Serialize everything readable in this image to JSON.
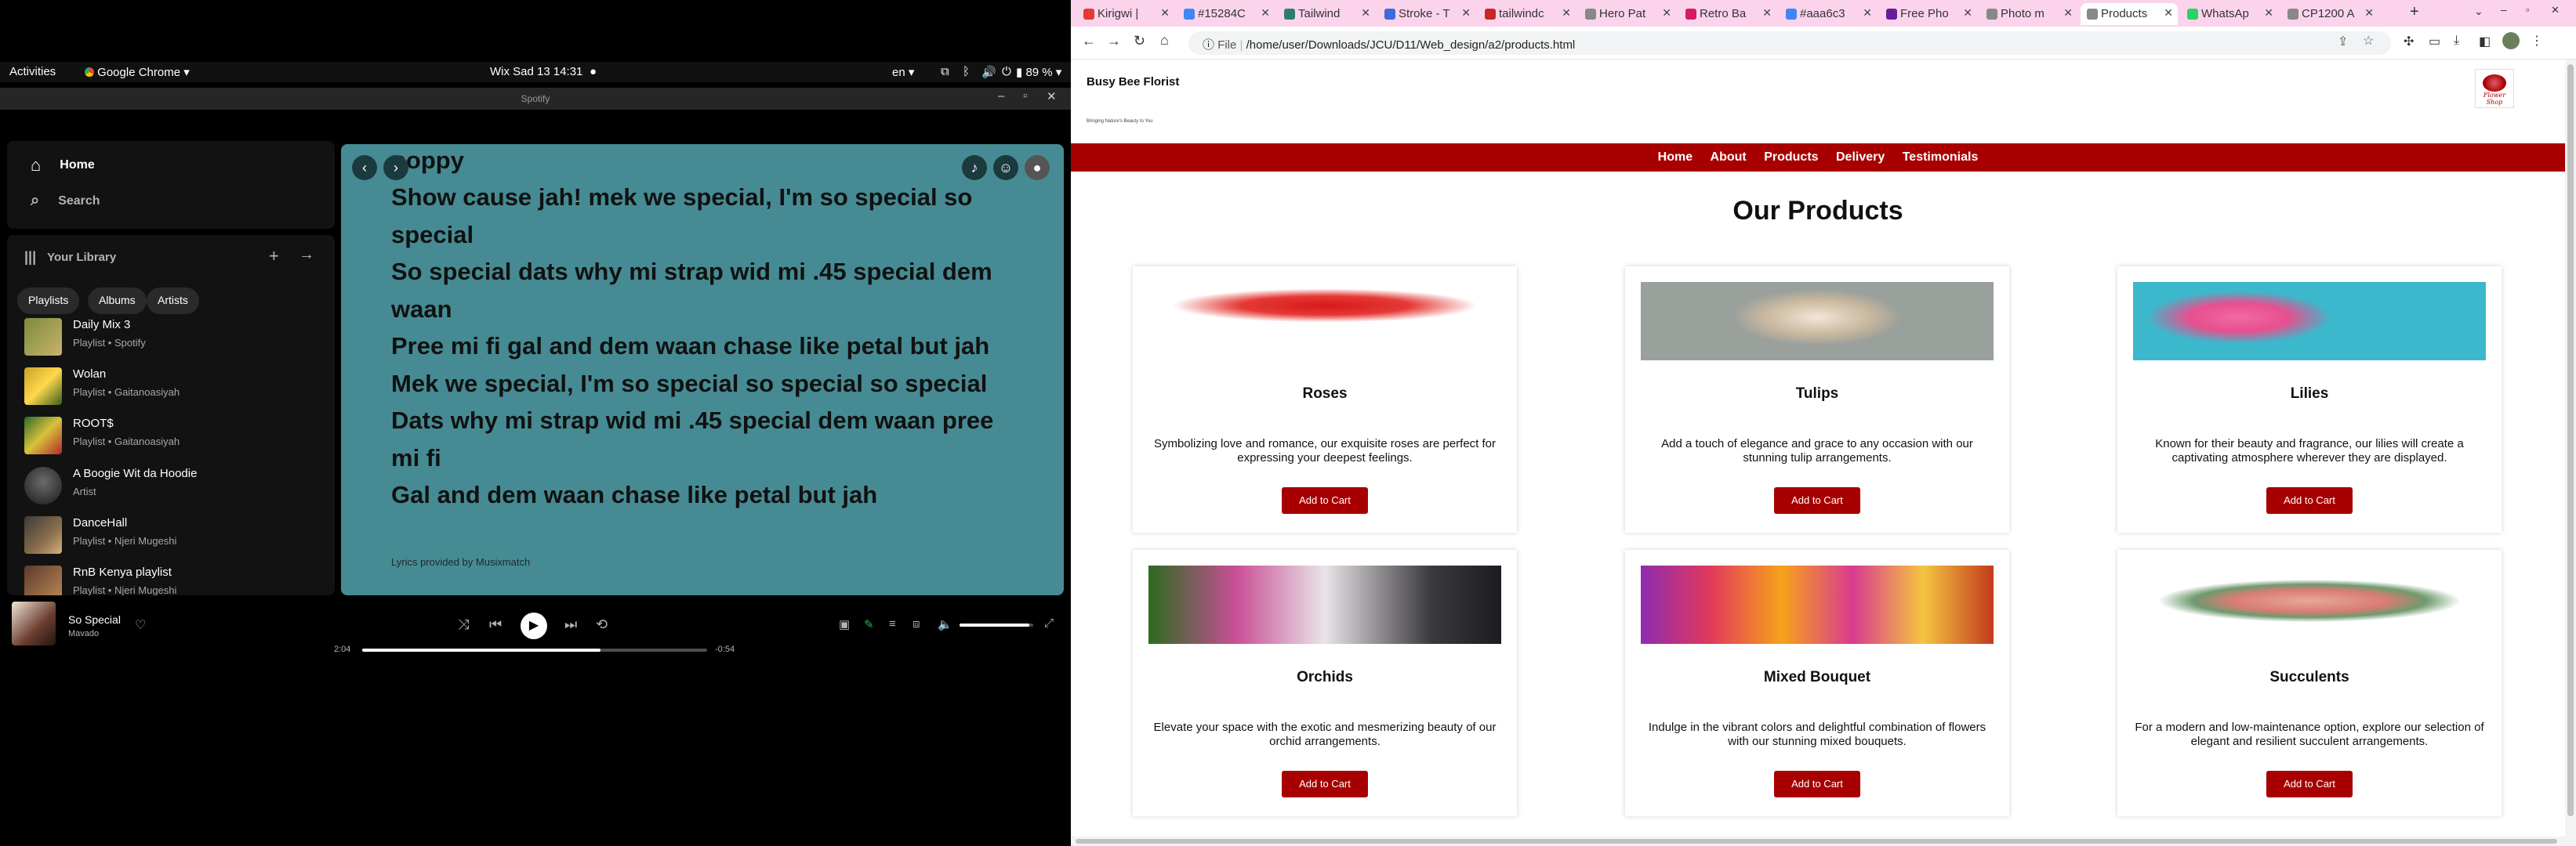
{
  "topbar": {
    "activities": "Activities",
    "app_menu": "Google Chrome",
    "clock": "Wix Sad 13  14:31",
    "keyboard": "en",
    "battery": "89 %"
  },
  "spotify_window": {
    "title": "Spotify"
  },
  "spotify": {
    "nav": {
      "home": "Home",
      "search": "Search"
    },
    "library": {
      "title": "Your Library",
      "filters": [
        "Playlists",
        "Albums",
        "Artists"
      ],
      "items": [
        {
          "name": "Daily Mix 3",
          "sub": "Playlist • Spotify"
        },
        {
          "name": "Wolan",
          "sub": "Playlist • Gaitanoasiyah"
        },
        {
          "name": "ROOT$",
          "sub": "Playlist • Gaitanoasiyah"
        },
        {
          "name": "A Boogie Wit da Hoodie",
          "sub": "Artist"
        },
        {
          "name": "DanceHall",
          "sub": "Playlist • Njeri Mugeshi"
        },
        {
          "name": "RnB Kenya playlist",
          "sub": "Playlist • Njeri Mugeshi"
        }
      ]
    },
    "lyrics": {
      "lines": [
        "poppy",
        "Show cause jah! mek we special, I'm so special so",
        "special",
        "So special dats why mi strap wid mi .45 special dem",
        "waan",
        "Pree mi fi gal and dem waan chase like petal but jah",
        "Mek we special, I'm so special so special so special",
        "Dats why mi strap wid mi .45 special dem waan pree",
        "mi fi",
        "Gal and dem waan chase like petal but jah"
      ],
      "credit": "Lyrics provided by Musixmatch"
    },
    "player": {
      "track": "So Special",
      "artist": "Mavado",
      "elapsed": "2:04",
      "remaining": "-0:54",
      "progress_fraction": 0.69,
      "volume_fraction": 0.95
    }
  },
  "browser": {
    "tabs": [
      {
        "label": "Kirigwi |",
        "color": "#e53935"
      },
      {
        "label": "#15284C",
        "color": "#4285f4"
      },
      {
        "label": "Tailwind",
        "color": "#2e7d6f"
      },
      {
        "label": "Stroke - T",
        "color": "#3f6ad8"
      },
      {
        "label": "tailwindc",
        "color": "#c62828"
      },
      {
        "label": "Hero Pat",
        "color": "#888888"
      },
      {
        "label": "Retro Ba",
        "color": "#d81b60"
      },
      {
        "label": "#aaa6c3",
        "color": "#4285f4"
      },
      {
        "label": "Free Pho",
        "color": "#6a1b9a"
      },
      {
        "label": "Photo m",
        "color": "#888888"
      },
      {
        "label": "Products",
        "color": "#888888",
        "active": true
      },
      {
        "label": "WhatsAp",
        "color": "#25d366"
      },
      {
        "label": "CP1200 A",
        "color": "#888888"
      }
    ],
    "url_scheme": "File",
    "url": "/home/user/Downloads/JCU/D11/Web_design/a2/products.html"
  },
  "site": {
    "brand": "Busy Bee Florist",
    "tagline": "Bringing Nature's Beauty to You",
    "logo_text": "Flower Shop",
    "nav": [
      "Home",
      "About",
      "Products",
      "Delivery",
      "Testimonials"
    ],
    "heading": "Our Products",
    "products": [
      {
        "title": "Roses",
        "desc": "Symbolizing love and romance, our exquisite roses are perfect for expressing your deepest feelings.",
        "button": "Add to Cart"
      },
      {
        "title": "Tulips",
        "desc": "Add a touch of elegance and grace to any occasion with our stunning tulip arrangements.",
        "button": "Add to Cart"
      },
      {
        "title": "Lilies",
        "desc": "Known for their beauty and fragrance, our lilies will create a captivating atmosphere wherever they are displayed.",
        "button": "Add to Cart"
      },
      {
        "title": "Orchids",
        "desc": "Elevate your space with the exotic and mesmerizing beauty of our orchid arrangements.",
        "button": "Add to Cart"
      },
      {
        "title": "Mixed Bouquet",
        "desc": "Indulge in the vibrant colors and delightful combination of flowers with our stunning mixed bouquets.",
        "button": "Add to Cart"
      },
      {
        "title": "Succulents",
        "desc": "For a modern and low-maintenance option, explore our selection of elegant and resilient succulent arrangements.",
        "button": "Add to Cart"
      }
    ]
  },
  "colors": {
    "site_accent": "#a80000",
    "lyrics_bg": "#468b93",
    "tabbar_bg": "#fbd4ec"
  }
}
